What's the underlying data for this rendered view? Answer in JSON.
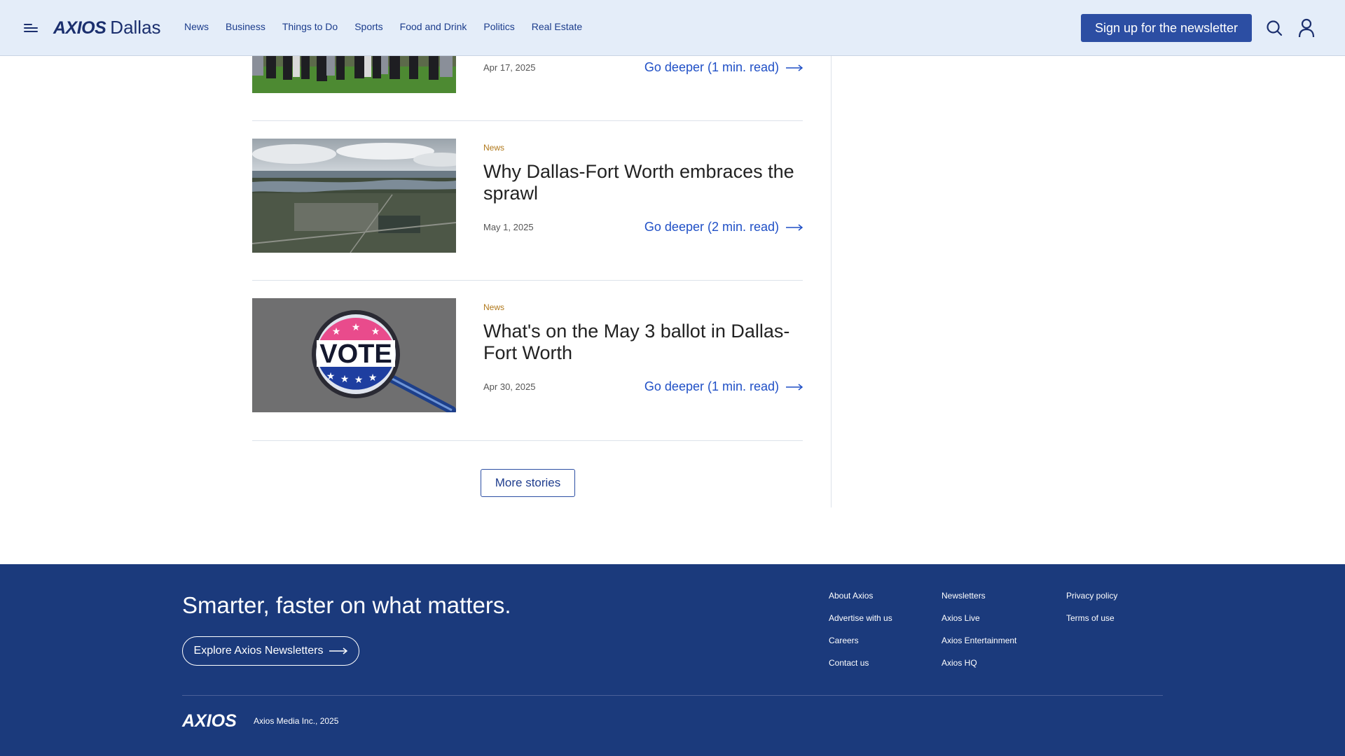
{
  "header": {
    "brand_logo": "AXIOS",
    "brand_city": "Dallas",
    "nav": [
      "News",
      "Business",
      "Things to Do",
      "Sports",
      "Food and Drink",
      "Politics",
      "Real Estate"
    ],
    "signup_label": "Sign up for the newsletter",
    "icons": [
      "menu-icon",
      "search-icon",
      "user-icon"
    ]
  },
  "stories": [
    {
      "kicker": "",
      "headline": "",
      "date": "Apr 17, 2025",
      "deeper": "Go deeper (1 min. read)"
    },
    {
      "kicker": "News",
      "headline": "Why Dallas-Fort Worth embraces the sprawl",
      "date": "May 1, 2025",
      "deeper": "Go deeper (2 min. read)"
    },
    {
      "kicker": "News",
      "headline": "What's on the May 3 ballot in Dallas-Fort Worth",
      "date": "Apr 30, 2025",
      "deeper": "Go deeper (1 min. read)"
    }
  ],
  "vote_badge_text": "VOTE",
  "more_stories_label": "More stories",
  "footer": {
    "tagline": "Smarter, faster on what matters.",
    "explore_label": "Explore Axios Newsletters",
    "col1": [
      "About Axios",
      "Advertise with us",
      "Careers",
      "Contact us"
    ],
    "col2": [
      "Newsletters",
      "Axios Live",
      "Axios Entertainment",
      "Axios HQ"
    ],
    "col3": [
      "Privacy policy",
      "Terms of use"
    ],
    "logo": "AXIOS",
    "copyright": "Axios Media Inc., 2025"
  },
  "colors": {
    "header_bg": "#e4edf9",
    "brand": "#1b2f6e",
    "signup_bg": "#2c4ea3",
    "link": "#1f4fc6",
    "kicker": "#b0781b",
    "footer_bg": "#1b3a7c"
  }
}
